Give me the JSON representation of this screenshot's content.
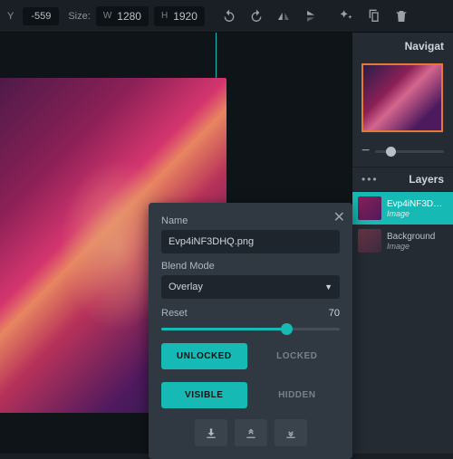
{
  "toolbar": {
    "y_label": "Y",
    "y_value": "-559",
    "size_label": "Size:",
    "w_label": "W",
    "w_value": "1280",
    "h_label": "H",
    "h_value": "1920"
  },
  "navigator": {
    "title": "Navigat"
  },
  "layers": {
    "title": "Layers",
    "items": [
      {
        "name": "Evp4iNF3DHQ.",
        "type": "Image"
      },
      {
        "name": "Background",
        "type": "Image"
      }
    ]
  },
  "dialog": {
    "name_label": "Name",
    "name_value": "Evp4iNF3DHQ.png",
    "blend_label": "Blend Mode",
    "blend_value": "Overlay",
    "reset_label": "Reset",
    "opacity_value": "70",
    "unlocked": "UNLOCKED",
    "locked": "LOCKED",
    "visible": "VISIBLE",
    "hidden": "HIDDEN"
  }
}
